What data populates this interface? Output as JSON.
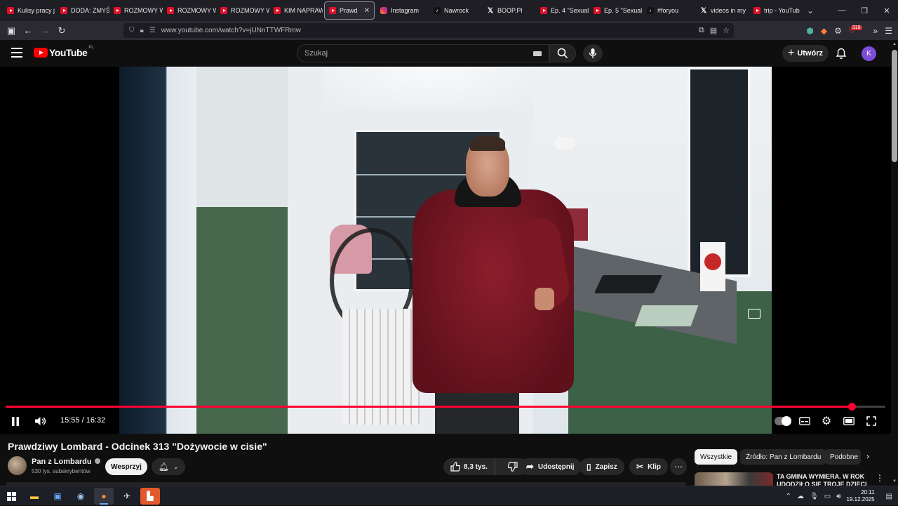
{
  "browser": {
    "tabs": [
      {
        "label": "Kulisy pracy j",
        "icon": "youtube"
      },
      {
        "label": "DODA: ZMYŚ",
        "icon": "youtube"
      },
      {
        "label": "ROZMOWY W",
        "icon": "youtube"
      },
      {
        "label": "ROZMOWY W",
        "icon": "youtube"
      },
      {
        "label": "ROZMOWY W",
        "icon": "youtube"
      },
      {
        "label": "KIM NAPRAW",
        "icon": "youtube"
      },
      {
        "label": "Prawd",
        "icon": "youtube",
        "active": true
      },
      {
        "label": "Instagram",
        "icon": "instagram"
      },
      {
        "label": "Nawrock",
        "icon": "tiktok"
      },
      {
        "label": "BOOP.Pl",
        "icon": "x"
      },
      {
        "label": "Ep. 4 \"Sexual",
        "icon": "youtube"
      },
      {
        "label": "Ep. 5 \"Sexual",
        "icon": "youtube"
      },
      {
        "label": "#foryou",
        "icon": "tiktok"
      },
      {
        "label": "videos in my",
        "icon": "x"
      },
      {
        "label": "trip - YouTub",
        "icon": "youtube"
      }
    ],
    "close_tab_glyph": "✕",
    "url": "www.youtube.com/watch?v=jUNnTTWFRmw",
    "extension_badge": "318"
  },
  "youtube": {
    "country_code": "PL",
    "logo_text": "YouTube",
    "search_placeholder": "Szukaj",
    "create_label": "Utwórz",
    "avatar_letter": "K"
  },
  "player": {
    "current_time": "15:55",
    "duration": "16:32",
    "progress_fraction": 0.9617,
    "time_display": "15:55 / 16:32"
  },
  "video": {
    "title": "Prawdziwy Lombard - Odcinek 313 \"Dożywocie w cisie\"",
    "channel_name": "Pan z Lombardu",
    "subscribers": "530 tys. subskrybentów",
    "support_label": "Wesprzyj",
    "likes": "8,3 tys.",
    "share_label": "Udostępnij",
    "save_label": "Zapisz",
    "clip_label": "Klip"
  },
  "recommendations": {
    "chips": [
      "Wszystkie",
      "Źródło: Pan z Lombardu",
      "Podobne"
    ],
    "first_title": "TA GMINA WYMIERA. W ROK UDODZIŁO SIĘ TROJE DZIECI"
  },
  "taskbar": {
    "time": "20:11",
    "date": "19.12.2025"
  },
  "colors": {
    "accent": "#ff0033",
    "background": "#0f0f0f",
    "avatar": "#7c4dd9"
  }
}
